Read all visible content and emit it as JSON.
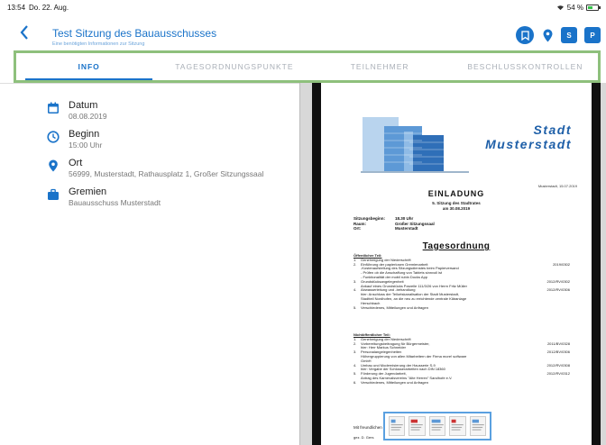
{
  "status_bar": {
    "time": "13:54",
    "date": "Do. 22. Aug.",
    "wifi_icon": "wifi-icon",
    "battery": "54 %",
    "battery_level": 0.54
  },
  "nav": {
    "title": "Test Sitzung des Bauausschusses",
    "subtitle": "Eine benötigten Informationen zur Sitzung",
    "icons": [
      "bookmark-icon",
      "map-pin-icon",
      "s-icon",
      "p-icon"
    ],
    "s_label": "S",
    "p_label": "P"
  },
  "tabs": [
    {
      "label": "INFO",
      "active": true
    },
    {
      "label": "TAGESORDNUNGSPUNKTE",
      "active": false
    },
    {
      "label": "TEILNEHMER",
      "active": false
    },
    {
      "label": "BESCHLUSSKONTROLLEN",
      "active": false
    }
  ],
  "info": [
    {
      "icon": "calendar-icon",
      "label": "Datum",
      "value": "08.08.2019"
    },
    {
      "icon": "clock-icon",
      "label": "Beginn",
      "value": "15:00 Uhr"
    },
    {
      "icon": "map-pin-icon",
      "label": "Ort",
      "value": "56999, Musterstadt, Rathausplatz 1, Großer Sitzungssaal"
    },
    {
      "icon": "briefcase-icon",
      "label": "Gremien",
      "value": "Bauausschuss Musterstadt"
    }
  ],
  "document": {
    "city_line1": "Stadt",
    "city_line2": "Musterstadt",
    "date_line": "Musterstadt, 15.07.2019",
    "heading": "EINLADUNG",
    "session_line1": "5. Sitzung des Stadtrates",
    "session_line2": "am 30.08.2019",
    "meta": [
      {
        "k": "Sitzungsbeginn:",
        "v": "18.30 Uhr"
      },
      {
        "k": "Raum:",
        "v": "Großer Sitzungssaal"
      },
      {
        "k": "Ort:",
        "v": "Musterstadt"
      }
    ],
    "agenda_title": "Tagesordnung",
    "public_head": "Öffentlicher Teil:",
    "public_items": [
      {
        "n": "1.",
        "t": "Genehmigung der Niederschrift",
        "r": ""
      },
      {
        "n": "2.",
        "t": "Einführung der papierlosen Gremienarbeit",
        "r": "2019/0302"
      },
      {
        "n": "",
        "t": "-Kostenaufstellung des Sitzungsdienstes beim Papierversand",
        "r": ""
      },
      {
        "n": "",
        "t": "- Prüfen ob die Anschaffung von Tablets sinnvoll ist",
        "r": ""
      },
      {
        "n": "",
        "t": "- Funktionalität der mobil rubin Docks App",
        "r": ""
      },
      {
        "n": "3.",
        "t": "Grundstücksangelegenheit",
        "r": "2012/RV/0302"
      },
      {
        "n": "",
        "t": "Ankauf eines Grundstücks Parzelle 111/3/26 von Herrn Fritz Müller",
        "r": ""
      },
      {
        "n": "4.",
        "t": "Abwasserleitung und -behandlung",
        "r": "2012/RV/0306"
      },
      {
        "n": "",
        "t": "hier: Anschluss der Teilortskanalisation der Stadt Musterstadt,",
        "r": ""
      },
      {
        "n": "",
        "t": "Stadtteil Nordhofen, an die neu zu errichtende zentrale Kläranlage",
        "r": ""
      },
      {
        "n": "",
        "t": "Herschbach",
        "r": ""
      },
      {
        "n": "5.",
        "t": "Verschiedenes, Mitteilungen und Anfragen",
        "r": ""
      }
    ],
    "private_head": "Nichtöffentlicher Teil:",
    "private_items": [
      {
        "n": "1.",
        "t": "Genehmigung der Niederschrift",
        "r": ""
      },
      {
        "n": "2.",
        "t": "Vorbereitungsbeitragung für Bürgermeister,",
        "r": "2011/BV/0328"
      },
      {
        "n": "",
        "t": "hier: Herr Markus Schneider",
        "r": ""
      },
      {
        "n": "3.",
        "t": "Personalangelegenheiten",
        "r": "2012/BV/0306"
      },
      {
        "n": "",
        "t": "Höhergruppierung von allen Mitarbeitern der Firma more! software",
        "r": ""
      },
      {
        "n": "",
        "t": "GmbH",
        "r": ""
      },
      {
        "n": "4.",
        "t": "Umbau und Modernisierung der Hausserie S-9",
        "r": "2012/RV/0308"
      },
      {
        "n": "",
        "t": "hier: Vergabe der Schlosserarbeiten nach DIN 18360",
        "r": ""
      },
      {
        "n": "5.",
        "t": "Förderung der Jugendarbeit,",
        "r": "2012/RV/0312"
      },
      {
        "n": "",
        "t": "Antrag des Karnevalsvereins \"Alte Herren\" Sandhofe e.V.",
        "r": ""
      },
      {
        "n": "6.",
        "t": "Verschiedenes, Mitteilungen und Anfragen",
        "r": ""
      }
    ],
    "greeting": "Mit freundlichen Grüßen",
    "signature": "gez. D. Gers"
  },
  "thumbnail_count": 5,
  "colors": {
    "accent": "#1a73c9",
    "tab_highlight": "#8ec07c",
    "city_blue": "#1e5fa8"
  }
}
